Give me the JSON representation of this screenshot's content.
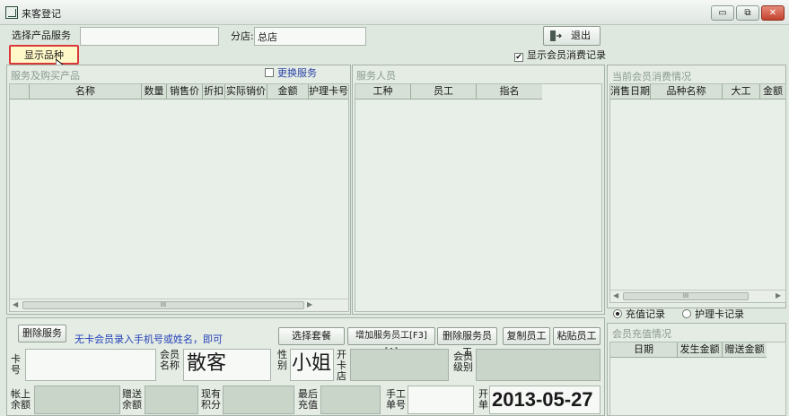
{
  "window": {
    "title": "来客登记",
    "minimize": "▭",
    "restore": "⧉",
    "close": "✕"
  },
  "top": {
    "product_service_label": "选择产品服务",
    "branch_label": "分店:",
    "branch_value": "总店",
    "show_variety_button": "显示品种",
    "exit_button": "退出",
    "exit_icon": "exit-door-icon",
    "show_member_records_label": "显示会员消费记录",
    "show_member_records_checked": "✔"
  },
  "left_panel": {
    "title": "服务及购买产品",
    "change_service_label": "更换服务",
    "columns": [
      "名称",
      "数量",
      "销售价",
      "折扣",
      "实际销价",
      "金额",
      "护理卡号"
    ],
    "scroll_thumb": "III"
  },
  "middle_panel": {
    "title": "服务人员",
    "columns": [
      "工种",
      "员工",
      "指名"
    ]
  },
  "right_panel": {
    "title": "当前会员消费情况",
    "columns": [
      "消售日期",
      "品种名称",
      "大工",
      "金额"
    ],
    "scroll_thumb": "III",
    "radio_recharge": "充值记录",
    "radio_care_card": "护理卡记录",
    "recharge_title": "会员充值情况",
    "recharge_columns": [
      "日期",
      "发生金额",
      "赠送金额"
    ]
  },
  "bottom": {
    "delete_service_button": "删除服务",
    "hint_text": "无卡会员录入手机号或姓名，即可",
    "select_package_button": "选择套餐",
    "add_staff_button": "增加服务员工[F3] [A]",
    "delete_staff_button": "删除服务员工",
    "copy_staff_button": "复制员工",
    "paste_staff_button": "粘贴员工",
    "card_no_label": "卡\n号",
    "member_name_label": "会员\n名称",
    "member_name_value": "散客",
    "gender_label": "性\n别",
    "gender_value": "小姐",
    "open_card_store_label": "开\n卡\n店",
    "member_level_label": "会员\n级别",
    "account_balance_label": "帐上\n余额",
    "gift_balance_label": "赠送\n余额",
    "current_points_label": "现有\n积分",
    "last_recharge_label": "最后\n充值",
    "manual_no_label": "手工\n单号",
    "bill_date_label": "开\n单",
    "bill_date_value": "2013-05-27"
  }
}
